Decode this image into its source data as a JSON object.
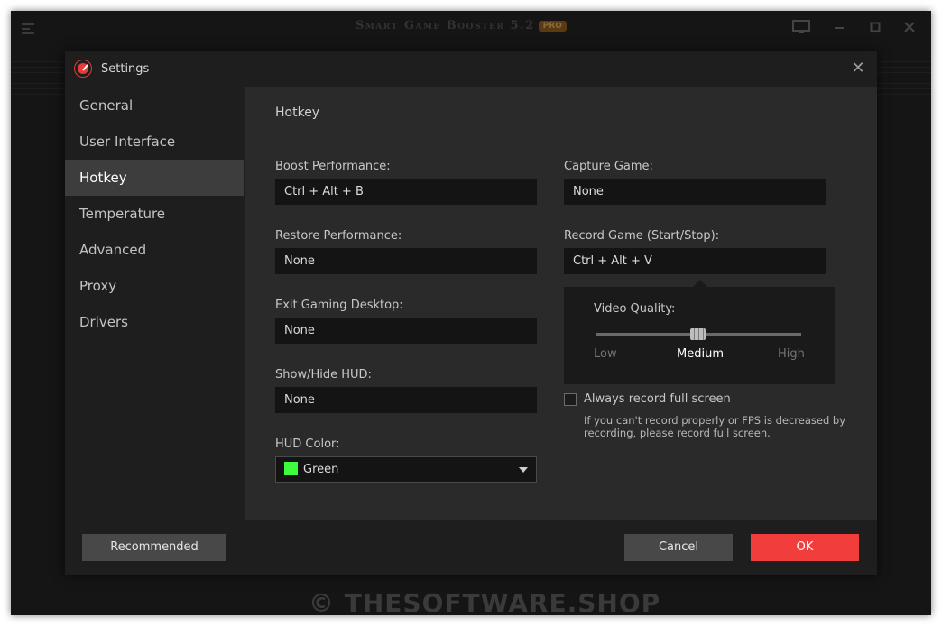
{
  "app": {
    "title": "Smart Game Booster 5.2",
    "badge": "PRO",
    "watermark": "© THESOFTWARE.SHOP"
  },
  "dialog": {
    "title": "Settings",
    "close_glyph": "✕"
  },
  "sidebar": {
    "items": [
      {
        "label": "General"
      },
      {
        "label": "User Interface"
      },
      {
        "label": "Hotkey",
        "active": true
      },
      {
        "label": "Temperature"
      },
      {
        "label": "Advanced"
      },
      {
        "label": "Proxy"
      },
      {
        "label": "Drivers"
      }
    ]
  },
  "hotkey": {
    "section_title": "Hotkey",
    "boost": {
      "label": "Boost Performance:",
      "value": "Ctrl + Alt + B"
    },
    "restore": {
      "label": "Restore Performance:",
      "value": "None"
    },
    "exit_desktop": {
      "label": "Exit Gaming Desktop:",
      "value": "None"
    },
    "show_hide_hud": {
      "label": "Show/Hide HUD:",
      "value": "None"
    },
    "hud_color": {
      "label": "HUD Color:",
      "value": "Green",
      "swatch": "#3dfc3d"
    },
    "capture_game": {
      "label": "Capture Game:",
      "value": "None"
    },
    "record_game": {
      "label": "Record Game (Start/Stop):",
      "value": "Ctrl + Alt + V"
    },
    "video_quality": {
      "label": "Video Quality:",
      "low": "Low",
      "medium": "Medium",
      "high": "High",
      "selected": "Medium"
    },
    "always_full_screen": {
      "label": "Always record full screen",
      "checked": false,
      "hint": "If you can't record properly or FPS is decreased by recording, please record full screen."
    }
  },
  "footer": {
    "recommended": "Recommended",
    "cancel": "Cancel",
    "ok": "OK"
  },
  "colors": {
    "accent_red": "#f23d3d",
    "active_tab": "#3d3d3d"
  }
}
